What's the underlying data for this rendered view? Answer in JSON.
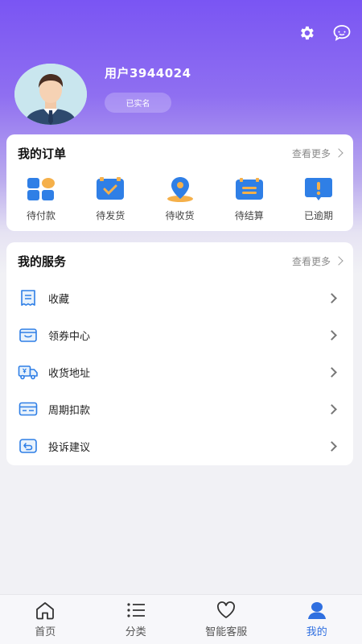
{
  "header": {
    "username": "用户3944024",
    "verify_status": "已实名",
    "icons": [
      "gear-icon",
      "chat-bubble-icon"
    ]
  },
  "orders": {
    "title": "我的订单",
    "more": "查看更多",
    "items": [
      {
        "label": "待付款",
        "icon": "grid-blocks-icon"
      },
      {
        "label": "待发货",
        "icon": "check-box-icon"
      },
      {
        "label": "待收货",
        "icon": "location-pin-icon"
      },
      {
        "label": "待结算",
        "icon": "list-card-icon"
      },
      {
        "label": "已逾期",
        "icon": "alert-bubble-icon"
      }
    ]
  },
  "services": {
    "title": "我的服务",
    "more": "查看更多",
    "items": [
      {
        "label": "收藏",
        "icon": "receipt-icon"
      },
      {
        "label": "领券中心",
        "icon": "coupon-icon"
      },
      {
        "label": "收货地址",
        "icon": "delivery-truck-icon"
      },
      {
        "label": "周期扣款",
        "icon": "card-icon"
      },
      {
        "label": "投诉建议",
        "icon": "feedback-icon"
      }
    ]
  },
  "tabbar": {
    "items": [
      {
        "label": "首页",
        "icon": "home-icon"
      },
      {
        "label": "分类",
        "icon": "list-icon"
      },
      {
        "label": "智能客服",
        "icon": "heart-icon"
      },
      {
        "label": "我的",
        "icon": "user-icon"
      }
    ],
    "active_index": 3,
    "active_color": "#2f6fe0"
  },
  "colors": {
    "header_gradient_top": "#7a55f3",
    "accent_blue": "#2f7fe6",
    "icon_orange": "#f5b04a"
  }
}
